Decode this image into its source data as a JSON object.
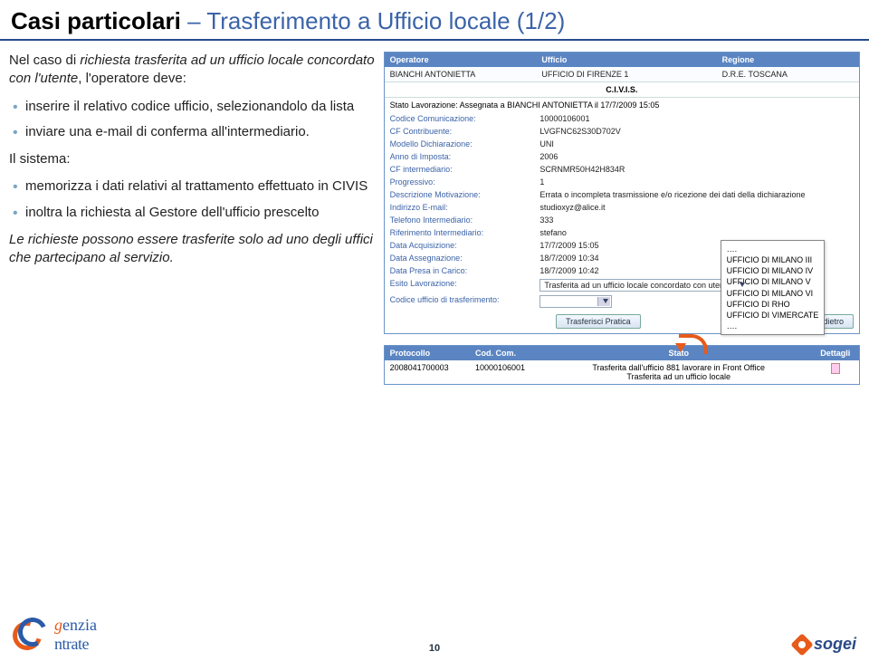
{
  "title": {
    "bold": "Casi particolari",
    "rest": "– Trasferimento a Ufficio locale (1/2)"
  },
  "left": {
    "intro_pre": "Nel caso di ",
    "intro_bold": "richiesta trasferita ad un ufficio locale concordato con l'utente",
    "intro_post": ", l'operatore deve:",
    "bullets_op": [
      "inserire il relativo codice ufficio, selezionandolo da lista",
      "inviare una e-mail di conferma all'intermediario."
    ],
    "sistema_label": "Il sistema:",
    "bullets_sys": [
      "memorizza i dati relativi al trattamento effettuato in CIVIS",
      "inoltra la richiesta al Gestore dell'ufficio prescelto"
    ],
    "outro": "Le richieste possono essere trasferite solo ad uno degli uffici che partecipano al servizio."
  },
  "panel_hdr": {
    "op": "Operatore",
    "uf": "Ufficio",
    "rg": "Regione"
  },
  "panel_val": {
    "op": "BIANCHI ANTONIETTA",
    "uf": "UFFICIO DI FIRENZE 1",
    "rg": "D.R.E. TOSCANA"
  },
  "civis": "C.I.V.I.S.",
  "stato_lav": "Stato Lavorazione: Assegnata a BIANCHI ANTONIETTA il 17/7/2009 15:05",
  "kv": [
    {
      "k": "Codice Comunicazione:",
      "v": "10000106001"
    },
    {
      "k": "CF Contribuente:",
      "v": "LVGFNC62S30D702V"
    },
    {
      "k": "Modello Dichiarazione:",
      "v": "UNI"
    },
    {
      "k": "Anno di Imposta:",
      "v": "2006"
    },
    {
      "k": "CF intermediario:",
      "v": "SCRNMR50H42H834R"
    },
    {
      "k": "Progressivo:",
      "v": "1"
    },
    {
      "k": "Descrizione Motivazione:",
      "v": "Errata o incompleta trasmissione e/o ricezione dei dati della dichiarazione"
    },
    {
      "k": "Indirizzo E-mail:",
      "v": "studioxyz@alice.it"
    },
    {
      "k": "Telefono Intermediario:",
      "v": "333"
    },
    {
      "k": "Riferimento Intermediario:",
      "v": "stefano"
    },
    {
      "k": "Data Acquisizione:",
      "v": "17/7/2009 15:05"
    },
    {
      "k": "Data Assegnazione:",
      "v": "18/7/2009 10:34"
    },
    {
      "k": "Data Presa in Carico:",
      "v": "18/7/2009 10:42"
    }
  ],
  "esito": {
    "label": "Esito Lavorazione:",
    "value": "Trasferita ad un ufficio locale concordato con utente"
  },
  "codice_uff": {
    "label": "Codice ufficio di trasferimento:"
  },
  "buttons": {
    "trasf": "Trasferisci Pratica",
    "indietro": "Indietro"
  },
  "dropdown": {
    "pre": "….",
    "items": [
      "UFFICIO DI MILANO III",
      "UFFICIO DI MILANO IV",
      "UFFICIO DI MILANO V",
      "UFFICIO DI MILANO VI",
      "UFFICIO DI RHO",
      "UFFICIO DI VIMERCATE"
    ],
    "post": "…."
  },
  "table2": {
    "hdr": {
      "prot": "Protocollo",
      "cod": "Cod. Com.",
      "stato": "Stato",
      "det": "Dettagli"
    },
    "row": {
      "prot": "2008041700003",
      "cod": "10000106001",
      "stato1": "Trasferita dall'ufficio 881 lavorare in Front Office",
      "stato2": "Trasferita ad un ufficio locale"
    }
  },
  "footer": {
    "ae_g": "g",
    "ae_enzia": "enzia",
    "ae_sub": "ntrate",
    "sogei": "sogei",
    "page": "10"
  }
}
